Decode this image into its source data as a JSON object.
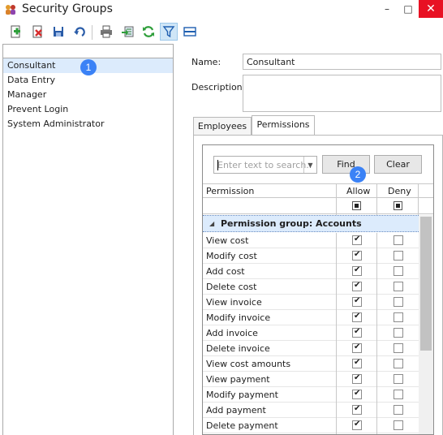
{
  "window": {
    "title": "Security Groups",
    "min": "–",
    "max": "□",
    "close": "✕"
  },
  "toolbar": {
    "icons": [
      "add-icon",
      "delete-icon",
      "save-icon",
      "undo-icon",
      "print-icon",
      "export-icon",
      "refresh-icon",
      "filter-icon",
      "layout-icon"
    ]
  },
  "groups": {
    "items": [
      {
        "label": "Consultant",
        "selected": true
      },
      {
        "label": "Data Entry"
      },
      {
        "label": "Manager"
      },
      {
        "label": "Prevent Login"
      },
      {
        "label": "System Administrator"
      }
    ]
  },
  "badges": {
    "one": "1",
    "two": "2"
  },
  "form": {
    "name_label": "Name:",
    "name_value": "Consultant",
    "description_label": "Description:",
    "description_value": ""
  },
  "tabs": {
    "employees": "Employees",
    "permissions": "Permissions"
  },
  "search": {
    "placeholder": "Enter text to search..",
    "find": "Find",
    "clear": "Clear"
  },
  "grid": {
    "columns": {
      "permission": "Permission",
      "allow": "Allow",
      "deny": "Deny"
    },
    "group_label": "Permission group: Accounts",
    "rows": [
      {
        "name": "View cost",
        "allow": true,
        "deny": false
      },
      {
        "name": "Modify cost",
        "allow": true,
        "deny": false
      },
      {
        "name": "Add cost",
        "allow": true,
        "deny": false
      },
      {
        "name": "Delete cost",
        "allow": true,
        "deny": false
      },
      {
        "name": "View invoice",
        "allow": true,
        "deny": false
      },
      {
        "name": "Modify invoice",
        "allow": true,
        "deny": false
      },
      {
        "name": "Add invoice",
        "allow": true,
        "deny": false
      },
      {
        "name": "Delete invoice",
        "allow": true,
        "deny": false
      },
      {
        "name": "View cost amounts",
        "allow": true,
        "deny": false
      },
      {
        "name": "View payment",
        "allow": true,
        "deny": false
      },
      {
        "name": "Modify payment",
        "allow": true,
        "deny": false
      },
      {
        "name": "Add payment",
        "allow": true,
        "deny": false
      },
      {
        "name": "Delete payment",
        "allow": true,
        "deny": false
      }
    ]
  },
  "colors": {
    "selection": "#dcebfc",
    "badge": "#3b82f6",
    "close": "#e81123"
  }
}
